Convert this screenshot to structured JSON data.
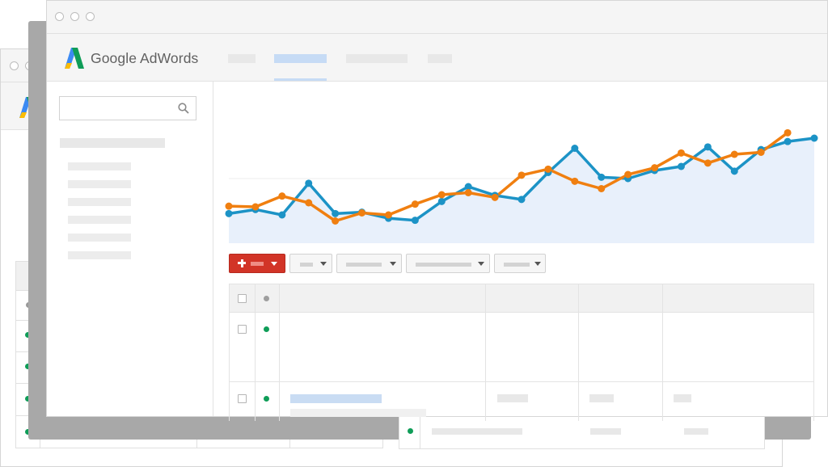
{
  "app": {
    "logo_text": "Google AdWords"
  },
  "colors": {
    "series_blue": "#1c93c6",
    "series_orange": "#f07f10",
    "area_fill": "#e8f0fb",
    "add_button_red": "#d23427",
    "status_enabled": "#0f9d58",
    "active_tab": "#c6dbf5"
  },
  "icons": {
    "search": "search-icon",
    "add": "plus-icon",
    "dropdown": "caret-down-icon"
  },
  "toolbar": {
    "add_button_label": "",
    "filter_dropdowns": [
      "",
      "",
      "",
      ""
    ]
  },
  "chart_data": {
    "type": "line",
    "title": "",
    "xlabel": "",
    "ylabel": "",
    "ylim": [
      0,
      100
    ],
    "x": [
      1,
      2,
      3,
      4,
      5,
      6,
      7,
      8,
      9,
      10,
      11,
      12,
      13,
      14,
      15,
      16,
      17,
      18,
      19,
      20,
      21,
      22,
      23
    ],
    "series": [
      {
        "values": [
          44,
          50,
          42,
          89,
          44,
          46,
          37,
          34,
          62,
          84,
          71,
          65,
          105,
          141,
          98,
          96,
          108,
          114,
          143,
          107,
          139,
          151,
          156
        ]
      },
      {
        "values": [
          55,
          54,
          70,
          60,
          33,
          45,
          42,
          58,
          72,
          75,
          68,
          101,
          110,
          92,
          81,
          102,
          112,
          134,
          119,
          132,
          135,
          164
        ]
      }
    ],
    "grid": false,
    "legend": "none"
  }
}
